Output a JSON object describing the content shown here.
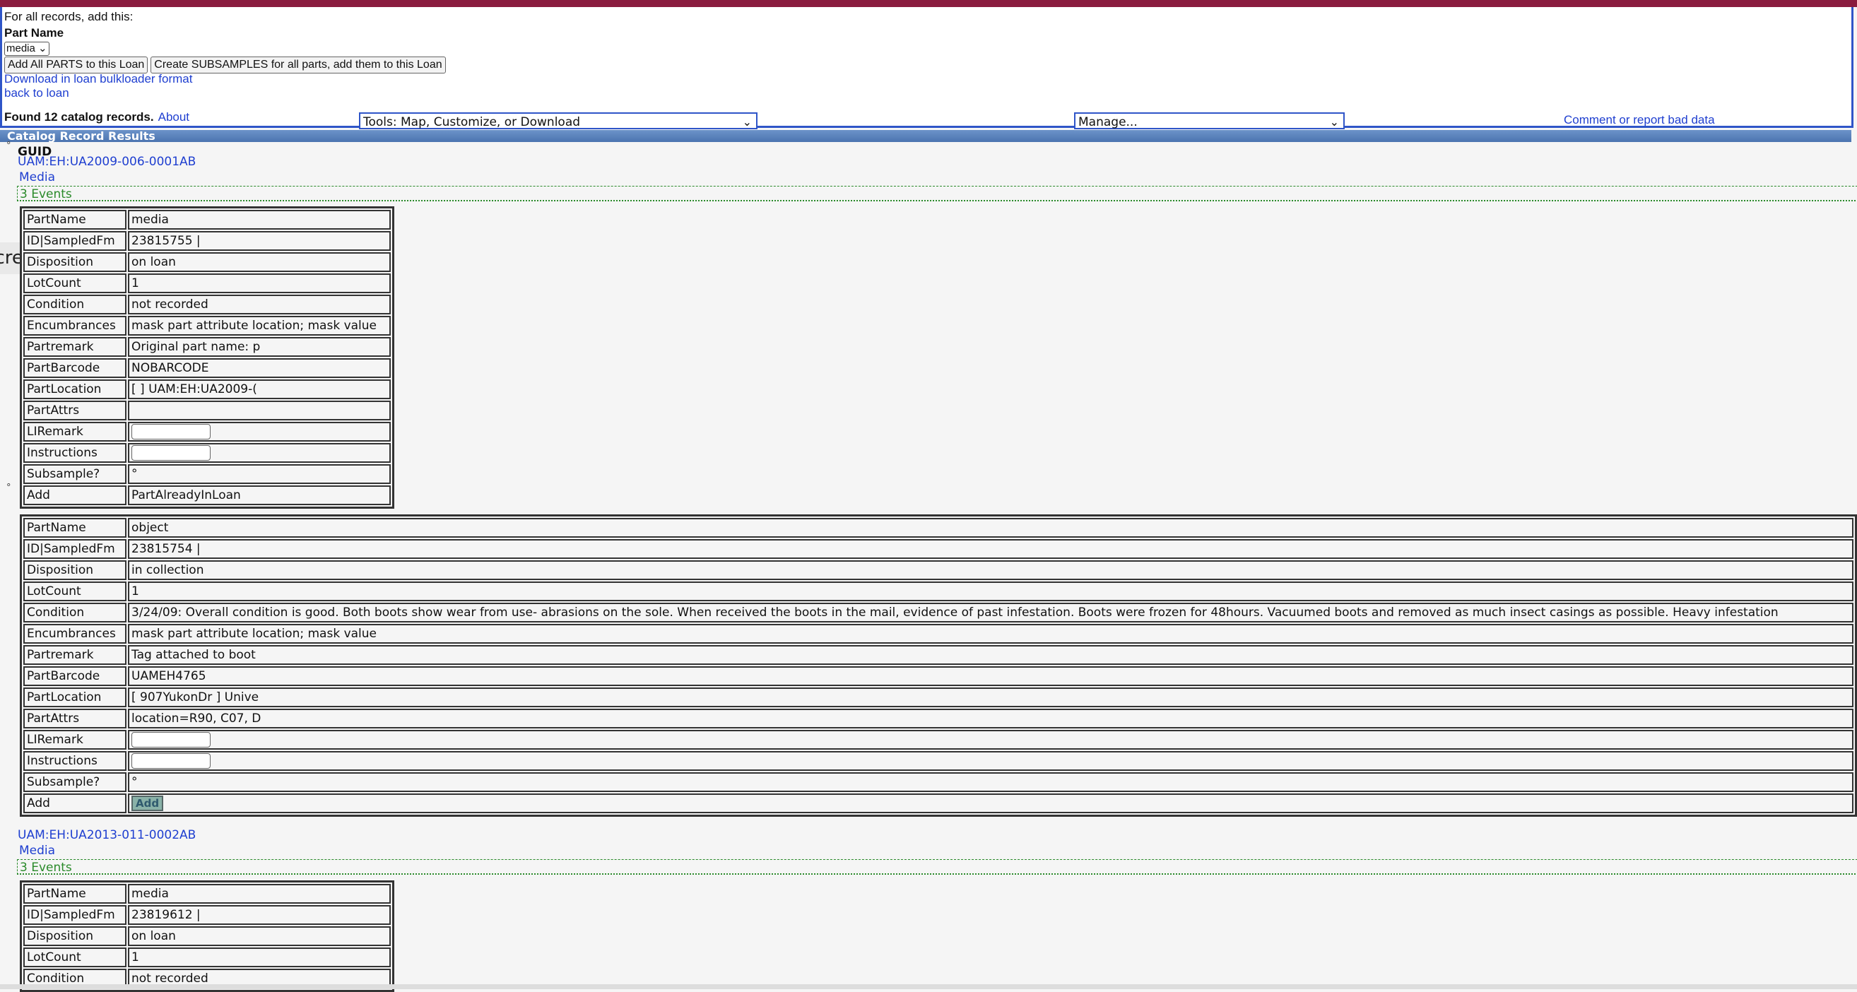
{
  "header": {
    "for_all": "For all records, add this:",
    "part_name_label": "Part Name",
    "part_name_value": "media",
    "add_all_btn": "Add All PARTS to this Loan",
    "create_sub_btn": "Create SUBSAMPLES for all parts, add them to this Loan",
    "download_link": "Download in loan bulkloader format",
    "back_link": "back to loan",
    "found": "Found 12 catalog records.",
    "about": "About",
    "tools_select": "Tools: Map, Customize, or Download",
    "manage_select": "Manage...",
    "comment_link": "Comment or report bad data"
  },
  "results_header": "Catalog Record Results",
  "guid_label": "GUID",
  "tooltip": "Screenshot",
  "records": [
    {
      "guid": "UAM:EH:UA2009-006-0001AB",
      "media": "Media",
      "events": "3 Events",
      "part1": {
        "PartName": "media",
        "ID|SampledFm": "23815755 |",
        "Disposition": "on loan",
        "LotCount": "1",
        "Condition": "not recorded",
        "Encumbrances": "mask part attribute location; mask value",
        "Partremark": "Original part name: p",
        "PartBarcode": "NOBARCODE",
        "PartLocation": "[ ] UAM:EH:UA2009-(",
        "PartAttrs": "",
        "Subsample": "°",
        "Add": "PartAlreadyInLoan"
      },
      "part2": {
        "PartName": "object",
        "ID|SampledFm": "23815754 |",
        "Disposition": "in collection",
        "LotCount": "1",
        "Condition": "3/24/09: Overall condition is good. Both boots show wear from use- abrasions on the sole. When received the boots in the mail, evidence of past infestation. Boots were frozen for 48hours. Vacuumed boots and removed as much insect casings as possible. Heavy infestation",
        "Encumbrances": "mask part attribute location; mask value",
        "Partremark": "Tag attached to boot",
        "PartBarcode": "UAMEH4765",
        "PartLocation": "[ 907YukonDr ] Unive",
        "PartAttrs": "location=R90, C07, D",
        "Subsample": "°",
        "Add": "Add"
      }
    },
    {
      "guid": "UAM:EH:UA2013-011-0002AB",
      "media": "Media",
      "events": "3 Events",
      "part1": {
        "PartName": "media",
        "ID|SampledFm": "23819612 |",
        "Disposition": "on loan",
        "LotCount": "1",
        "Condition": "not recorded"
      }
    }
  ],
  "labels": {
    "PartName": "PartName",
    "ID": "ID|SampledFm",
    "Disposition": "Disposition",
    "LotCount": "LotCount",
    "Condition": "Condition",
    "Encumbrances": "Encumbrances",
    "Partremark": "Partremark",
    "PartBarcode": "PartBarcode",
    "PartLocation": "PartLocation",
    "PartAttrs": "PartAttrs",
    "LIRemark": "LIRemark",
    "Instructions": "Instructions",
    "Subsample": "Subsample?",
    "Add": "Add"
  }
}
